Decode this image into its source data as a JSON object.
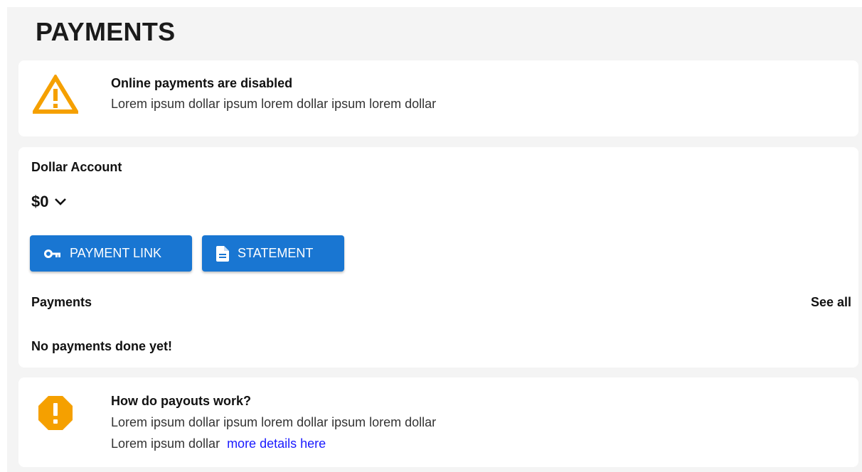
{
  "page": {
    "title": "PAYMENTS"
  },
  "alert": {
    "icon": "warning-triangle-icon",
    "title": "Online payments are disabled",
    "body": "Lorem ipsum dollar ipsum lorem dollar ipsum lorem dollar",
    "color": "#f5a000"
  },
  "account": {
    "label": "Dollar Account",
    "balance": "$0",
    "buttons": {
      "payment_link": "PAYMENT LINK",
      "statement": "STATEMENT"
    },
    "button_color": "#1976d2",
    "payments_label": "Payments",
    "see_all": "See all",
    "empty_message": "No payments done yet!"
  },
  "payouts": {
    "icon": "exclamation-octagon-icon",
    "title": "How do payouts work?",
    "body_line1": "Lorem ipsum dollar ipsum lorem dollar ipsum lorem dollar",
    "body_line2": "Lorem ipsum dollar",
    "link_text": "more details here",
    "color": "#f5a000"
  }
}
